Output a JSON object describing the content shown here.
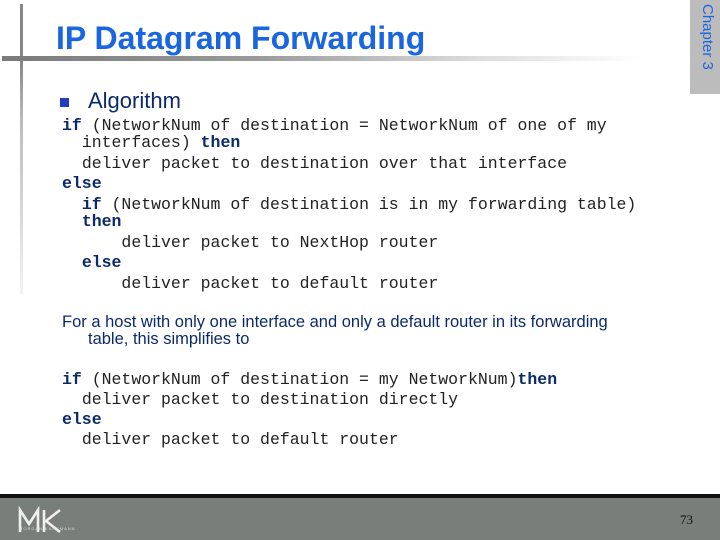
{
  "slide": {
    "title": "IP Datagram Forwarding",
    "chapter_tab": "Chapter 3",
    "bullet": "Algorithm",
    "algorithm_lines": [
      {
        "indent": "",
        "kw": "if",
        "text": " (NetworkNum of destination = NetworkNum of one of my",
        "kw2": ""
      },
      {
        "indent": "  ",
        "kw": "",
        "text": "interfaces) ",
        "kw2": "then"
      },
      {
        "indent": "  ",
        "kw": "",
        "text": "deliver packet to destination over that interface",
        "kw2": ""
      },
      {
        "indent": "",
        "kw": "else",
        "text": "",
        "kw2": ""
      },
      {
        "indent": "  ",
        "kw": "if",
        "text": " (NetworkNum of destination is in my forwarding table)",
        "kw2": ""
      },
      {
        "indent": "  ",
        "kw": "then",
        "text": "",
        "kw2": ""
      },
      {
        "indent": "      ",
        "kw": "",
        "text": "deliver packet to NextHop router",
        "kw2": ""
      },
      {
        "indent": "  ",
        "kw": "else",
        "text": "",
        "kw2": ""
      },
      {
        "indent": "      ",
        "kw": "",
        "text": "deliver packet to default router",
        "kw2": ""
      }
    ],
    "paragraph_line1": "For a host with only one interface and only a default router in its forwarding",
    "paragraph_line2": "table, this simplifies to",
    "simplified_lines": [
      {
        "indent": "",
        "kw": "if",
        "text": " (NetworkNum of destination = my NetworkNum)",
        "kw2": "then"
      },
      {
        "indent": "  ",
        "kw": "",
        "text": "deliver packet to destination directly",
        "kw2": ""
      },
      {
        "indent": "",
        "kw": "else",
        "text": "",
        "kw2": ""
      },
      {
        "indent": "  ",
        "kw": "",
        "text": "deliver packet to default router",
        "kw2": ""
      }
    ]
  },
  "footer": {
    "logo": "MK",
    "logo_subtitle": "MORGAN KAUFMANN",
    "page_number": "73"
  }
}
